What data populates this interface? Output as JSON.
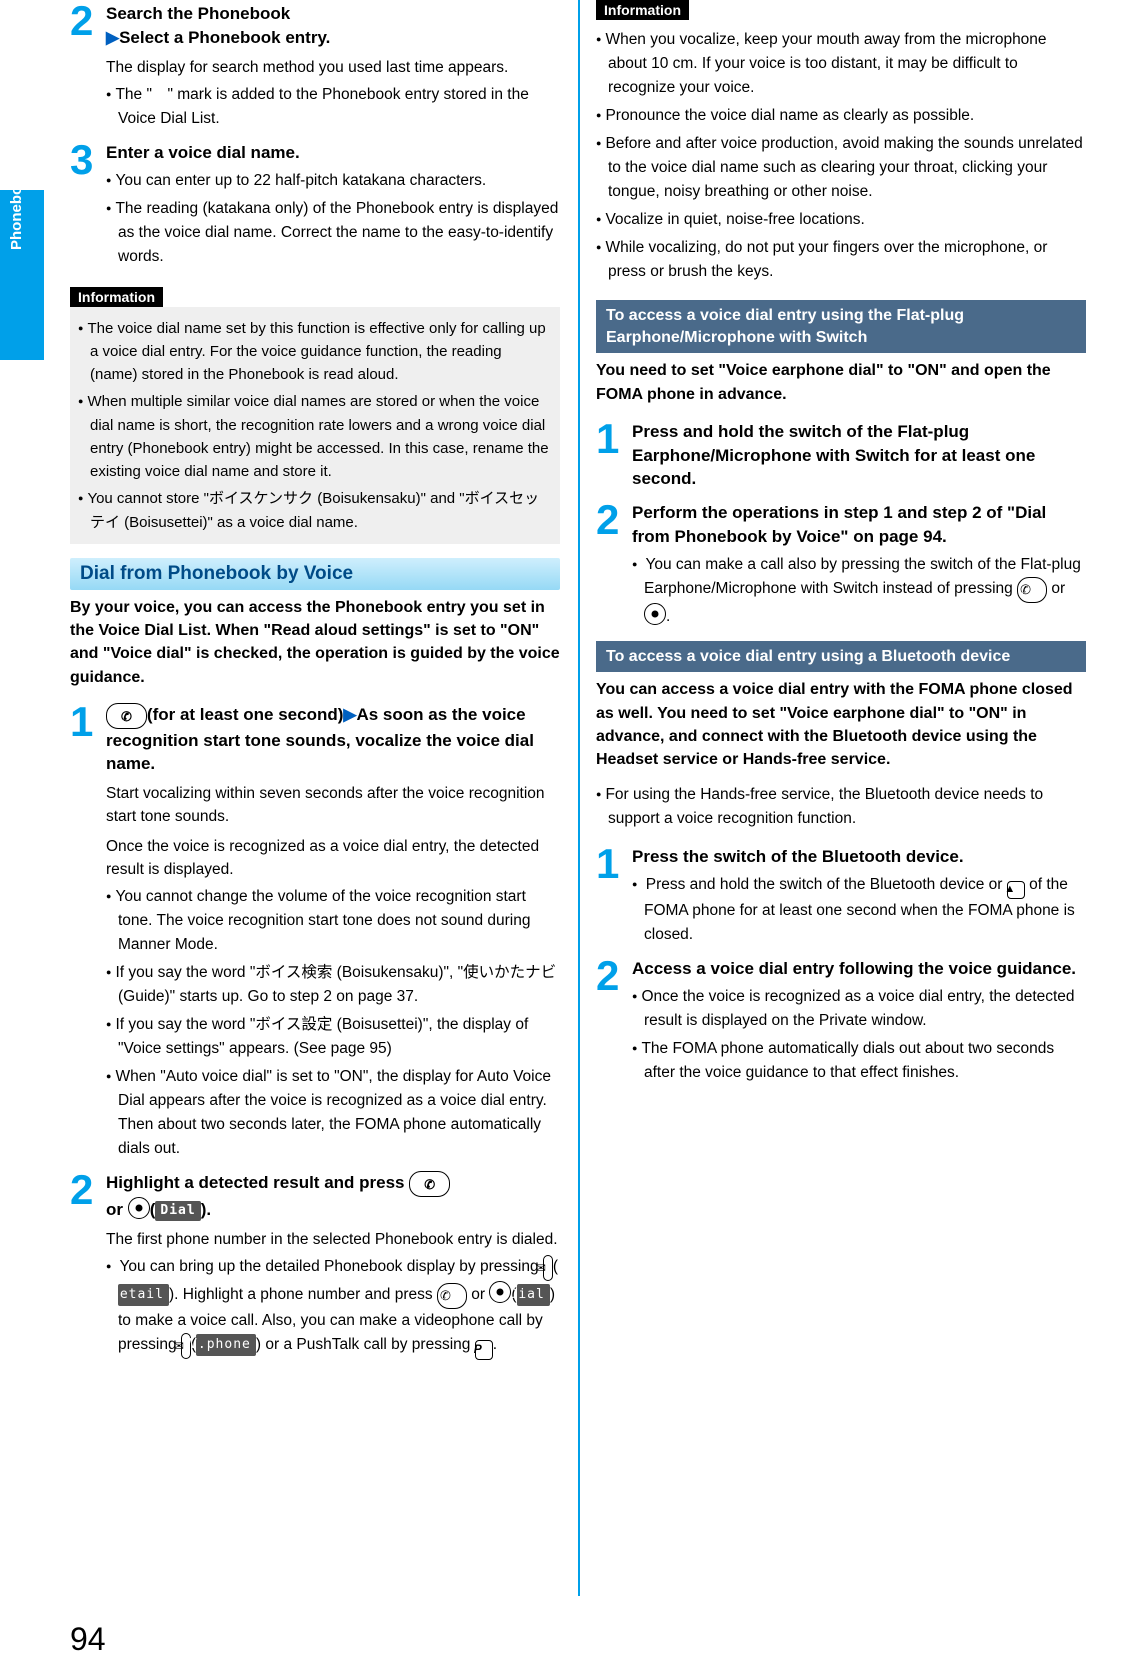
{
  "side_tab": "Phonebook",
  "page_number": "94",
  "left": {
    "step2": {
      "title_a": "Search the Phonebook",
      "title_b": "Select a Phonebook entry.",
      "desc": "The display for search method you used last time appears.",
      "b1": "The \"　\" mark is added to the Phonebook entry stored in the Voice Dial List."
    },
    "step3": {
      "title": "Enter a voice dial name.",
      "b1": "You can enter up to 22 half-pitch katakana characters.",
      "b2": "The reading (katakana only) of the Phonebook entry is displayed as the voice dial name. Correct the name to the easy-to-identify words."
    },
    "info1_label": "Information",
    "info1": {
      "b1": "The voice dial name set by this function is effective only for calling up a voice dial entry. For the voice guidance function, the reading (name) stored in the Phonebook is read aloud.",
      "b2": "When multiple similar voice dial names are stored or when the voice dial name is short, the recognition rate lowers and a wrong voice dial entry (Phonebook entry) might be accessed. In this case, rename the existing voice dial name and store it.",
      "b3": "You cannot store \"ボイスケンサク (Boisukensaku)\" and \"ボイスセッテイ (Boisusettei)\" as a voice dial name."
    },
    "section_head": "Dial from Phonebook by Voice",
    "intro": "By your voice, you can access the Phonebook entry you set in the Voice Dial List. When \"Read aloud settings\" is set to \"ON\" and \"Voice dial\" is checked, the operation is guided by the voice guidance.",
    "vstep1": {
      "title_a": "(for at least one second)",
      "title_b": "As soon as the voice recognition start tone sounds, vocalize the voice dial name.",
      "desc1": "Start vocalizing within seven seconds after the voice recognition start tone sounds.",
      "desc2": "Once the voice is recognized as a voice dial entry, the detected result is displayed.",
      "b1": "You cannot change the volume of the voice recognition start tone. The voice recognition start tone does not sound during Manner Mode.",
      "b2": "If you say the word \"ボイス検索 (Boisukensaku)\", \"使いかたナビ (Guide)\" starts up. Go to step 2 on page 37.",
      "b3": "If you say the word \"ボイス設定 (Boisusettei)\", the display of \"Voice settings\" appears. (See page 95)",
      "b4": "When \"Auto voice dial\" is set to \"ON\", the display for Auto Voice Dial appears after the voice is recognized as a voice dial entry. Then about two seconds later, the FOMA phone automatically dials out."
    },
    "vstep2": {
      "title_a": "Highlight a detected result and press ",
      "title_b": "or ",
      "desc": "The first phone number in the selected Phonebook entry is dialed.",
      "b1_a": "You can bring up the detailed Phonebook display by pressing ",
      "b1_b": ". Highlight a phone number and press ",
      "b1_c": " or ",
      "b1_d": " to make a voice call. Also, you can make a videophone call by pressing ",
      "b1_e": " or a PushTalk call by pressing "
    },
    "soft_dial": "Dial",
    "soft_detail": "Detail",
    "soft_vphone": "V.phone"
  },
  "right": {
    "info_label": "Information",
    "info": {
      "b1": "When you vocalize, keep your mouth away from the microphone about 10 cm. If your voice is too distant, it may be difficult to recognize your voice.",
      "b2": "Pronounce the voice dial name as clearly as possible.",
      "b3": "Before and after voice production, avoid making the sounds unrelated to the voice dial name such as clearing your throat, clicking your tongue, noisy breathing or other noise.",
      "b4": "Vocalize in quiet, noise-free locations.",
      "b5": "While vocalizing, do not put your fingers over the microphone, or press or brush the keys."
    },
    "sub1": "To access a voice dial entry using the Flat-plug Earphone/Microphone with Switch",
    "sub1_intro": "You need to set \"Voice earphone dial\" to \"ON\" and open the FOMA phone in advance.",
    "s1step1": "Press and hold the switch of the Flat-plug Earphone/Microphone with Switch for at least one second.",
    "s1step2": "Perform the operations in step 1 and step 2 of \"Dial from Phonebook by Voice\" on page 94.",
    "s1step2_b1_a": "You can make a call also by pressing the switch of the Flat-plug Earphone/Microphone with Switch instead of pressing ",
    "s1step2_b1_b": " or ",
    "sub2": "To access a voice dial entry using a Bluetooth device",
    "sub2_intro": "You can access a voice dial entry with the FOMA phone closed as well. You need to set \"Voice earphone dial\" to \"ON\" in advance, and connect with the Bluetooth device using the Headset service or Hands-free service.",
    "sub2_b1": "For using the Hands-free service, the Bluetooth device needs to support a voice recognition function.",
    "s2step1": "Press the switch of the Bluetooth device.",
    "s2step1_b1_a": "Press and hold the switch of the Bluetooth device or ",
    "s2step1_b1_b": " of the FOMA phone for at least one second when the FOMA phone is closed.",
    "s2step2": "Access a voice dial entry following the voice guidance.",
    "s2step2_b1": "Once the voice is recognized as a voice dial entry, the detected result is displayed on the Private window.",
    "s2step2_b2": "The FOMA phone automatically dials out about two seconds after the voice guidance to that effect finishes."
  }
}
